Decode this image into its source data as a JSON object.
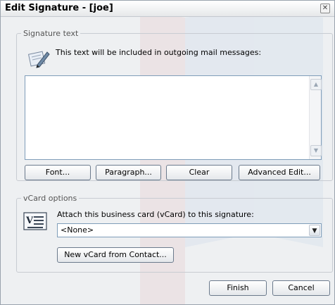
{
  "window": {
    "title": "Edit Signature - [joe]",
    "close_icon": "close-icon"
  },
  "signature_group": {
    "legend": "Signature text",
    "icon": "pen-writing-icon",
    "description": "This text will be included in outgoing mail messages:",
    "editor_value": "",
    "buttons": {
      "font": "Font...",
      "paragraph": "Paragraph...",
      "clear": "Clear",
      "advanced_edit": "Advanced Edit..."
    }
  },
  "vcard_group": {
    "legend": "vCard options",
    "icon": "vcard-icon",
    "description": "Attach this business card (vCard) to this signature:",
    "selected": "<None>",
    "new_button": "New vCard from Contact..."
  },
  "footer": {
    "finish": "Finish",
    "cancel": "Cancel"
  },
  "colors": {
    "window_bg": "#eef0f2",
    "field_border": "#7f9db9",
    "watermark": "#c33a4a"
  }
}
